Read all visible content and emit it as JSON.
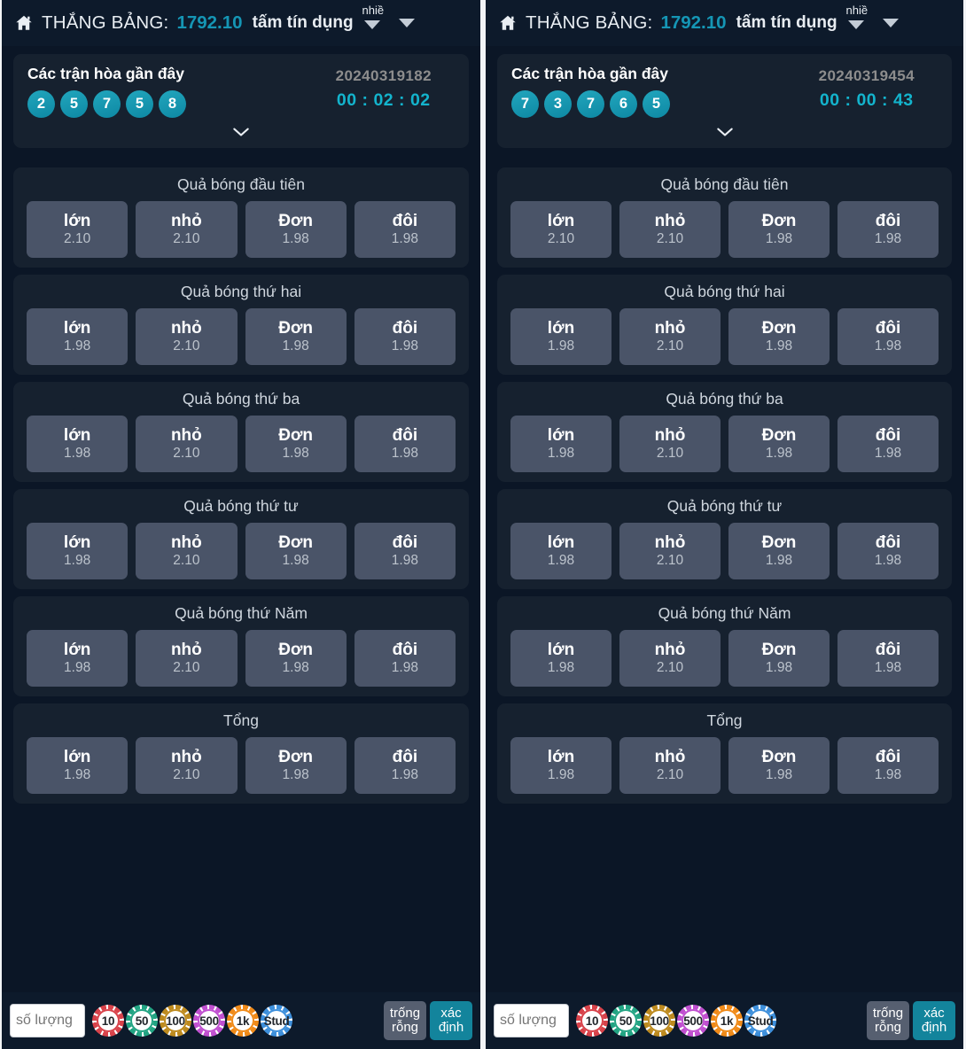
{
  "app": {
    "home_icon": "home-icon",
    "title_prefix": "THẮNG BẢNG:",
    "balance": "1792.10",
    "credit_label": "tấm tín dụng",
    "credit_more_label": "nhiề",
    "caret_icon": "chevron-down-icon",
    "menu_icon": "chevron-down-icon"
  },
  "colors": {
    "page_bg": "#0b1626",
    "panel_bg": "#16212f",
    "accent_teal": "#13b4cd",
    "balance_teal": "#1596b5",
    "bet_button": "#4a5468",
    "confirm": "#13849c",
    "clear": "#565f70"
  },
  "results": {
    "title": "Các trận hòa gần đây",
    "expand_icon": "chevron-down-icon"
  },
  "bet_labels": [
    "lớn",
    "nhỏ",
    "Đơn",
    "đôi"
  ],
  "groups": [
    {
      "title": "Quả bóng đầu tiên",
      "odds": [
        "2.10",
        "2.10",
        "1.98",
        "1.98"
      ]
    },
    {
      "title": "Quả bóng thứ hai",
      "odds": [
        "1.98",
        "2.10",
        "1.98",
        "1.98"
      ]
    },
    {
      "title": "Quả bóng thứ ba",
      "odds": [
        "1.98",
        "2.10",
        "1.98",
        "1.98"
      ]
    },
    {
      "title": "Quả bóng thứ tư",
      "odds": [
        "1.98",
        "2.10",
        "1.98",
        "1.98"
      ]
    },
    {
      "title": "Quả bóng thứ Năm",
      "odds": [
        "1.98",
        "2.10",
        "1.98",
        "1.98"
      ]
    },
    {
      "title": "Tổng",
      "odds": [
        "1.98",
        "2.10",
        "1.98",
        "1.98"
      ]
    }
  ],
  "bottom": {
    "amount_placeholder": "số lượng",
    "chips": [
      {
        "label": "10",
        "color": "#d8424a"
      },
      {
        "label": "50",
        "color": "#22a483"
      },
      {
        "label": "100",
        "color": "#bd8a1e"
      },
      {
        "label": "500",
        "color": "#c04fd0"
      },
      {
        "label": "1k",
        "color": "#f08a18"
      },
      {
        "label": "Stud",
        "color": "#3d8fdb"
      }
    ],
    "clear_line1": "trống",
    "clear_line2": "rỗng",
    "confirm_line1": "xác",
    "confirm_line2": "định"
  },
  "panels": [
    {
      "period": "20240319182",
      "timer": "00 : 02 : 02",
      "balls": [
        "2",
        "5",
        "7",
        "5",
        "8"
      ]
    },
    {
      "period": "20240319454",
      "timer": "00 : 00 : 43",
      "balls": [
        "7",
        "3",
        "7",
        "6",
        "5"
      ]
    }
  ]
}
